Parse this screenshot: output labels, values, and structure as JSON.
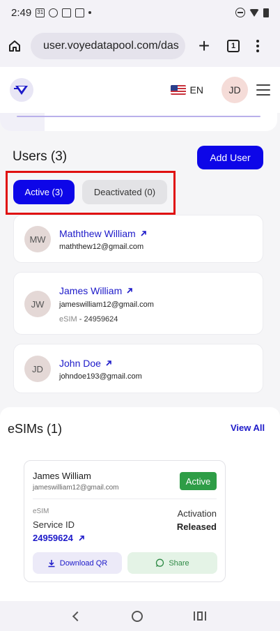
{
  "status_bar": {
    "time": "2:49",
    "calendar_day": "31"
  },
  "browser": {
    "url": "user.voyedatapool.com/das",
    "tab_count": "1"
  },
  "header": {
    "language": "EN",
    "avatar_initials": "JD"
  },
  "users": {
    "title": "Users (3)",
    "add_button": "Add User",
    "tabs": [
      {
        "label": "Active (3)",
        "selected": true
      },
      {
        "label": "Deactivated (0)",
        "selected": false
      }
    ],
    "list": [
      {
        "initials": "MW",
        "name": "Maththew William",
        "email": "maththew12@gmail.com"
      },
      {
        "initials": "JW",
        "name": "James William",
        "email": "jameswilliam12@gmail.com",
        "sim_label": "eSIM",
        "sim_number": "- 24959624"
      },
      {
        "initials": "JD",
        "name": "John Doe",
        "email": "johndoe193@gmail.com"
      }
    ]
  },
  "esims": {
    "title": "eSIMs (1)",
    "view_all": "View All",
    "card": {
      "name": "James William",
      "email": "jameswilliam12@gmail.com",
      "status": "Active",
      "esim_label": "eSIM",
      "service_id_label": "Service ID",
      "service_id": "24959624",
      "activation_label": "Activation",
      "activation_value": "Released",
      "download_label": "Download QR",
      "share_label": "Share"
    }
  },
  "colors": {
    "primary": "#0d06e8",
    "link": "#1d1ac9",
    "success": "#2e9d46",
    "highlight": "#e01010"
  }
}
